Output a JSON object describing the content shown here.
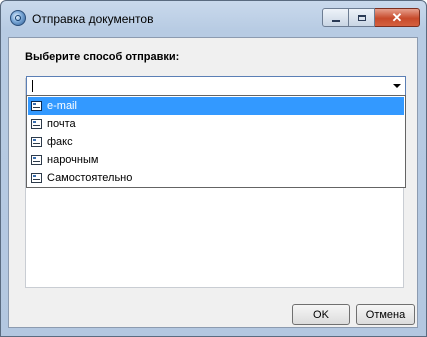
{
  "window": {
    "title": "Отправка документов",
    "icon": "app-globe-icon"
  },
  "caption_buttons": {
    "minimize_icon": "minimize-icon",
    "maximize_icon": "maximize-icon",
    "close_icon": "close-icon",
    "close_glyph": "✕"
  },
  "form": {
    "prompt": "Выберите способ отправки:",
    "combo_value": ""
  },
  "dropdown": {
    "items": [
      {
        "label": "e-mail",
        "selected": true
      },
      {
        "label": "почта",
        "selected": false
      },
      {
        "label": "факс",
        "selected": false
      },
      {
        "label": "нарочным",
        "selected": false
      },
      {
        "label": "Самостоятельно",
        "selected": false
      }
    ],
    "selection_color": "#3399ff"
  },
  "buttons": {
    "ok": "OK",
    "cancel": "Отмена"
  }
}
